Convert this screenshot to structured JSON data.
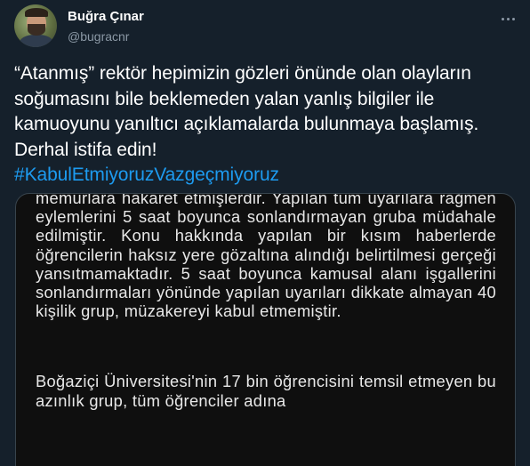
{
  "author": {
    "name": "Buğra Çınar",
    "handle": "@bugracnr"
  },
  "tweet": {
    "text": "“Atanmış” rektör hepimizin gözleri önünde olan olayların soğumasını bile beklemeden yalan yanlış bilgiler ile kamuoyunu yanıltıcı açıklamalarda bulunmaya başlamış. Derhal istifa edin!",
    "hashtag": "#KabulEtmiyoruzVazgeçmiyoruz"
  },
  "media": {
    "paragraph1": "memurlara hakaret etmişlerdir. Yapılan tüm uyarılara rağmen eylemlerini 5 saat boyunca sonlandırmayan gruba müdahale edilmiştir. Konu hakkında yapılan bir kısım haberlerde öğrencilerin haksız yere gözaltına alındığı belirtilmesi gerçeği yansıtmamaktadır. 5 saat boyunca kamusal alanı işgallerini sonlandırmaları yönünde yapılan uyarıları dikkate almayan 40 kişilik grup, müzakereyi kabul etmemiştir.",
    "paragraph2": "Boğaziçi Üniversitesi'nin 17 bin öğrencisini temsil etmeyen bu azınlık grup, tüm öğrenciler adına"
  },
  "colors": {
    "background": "#15202b",
    "hashtag": "#1d9bf0",
    "secondary_text": "#8b98a5",
    "media_background": "#0f0f0f"
  },
  "icons": {
    "more": "more-horizontal-icon"
  }
}
